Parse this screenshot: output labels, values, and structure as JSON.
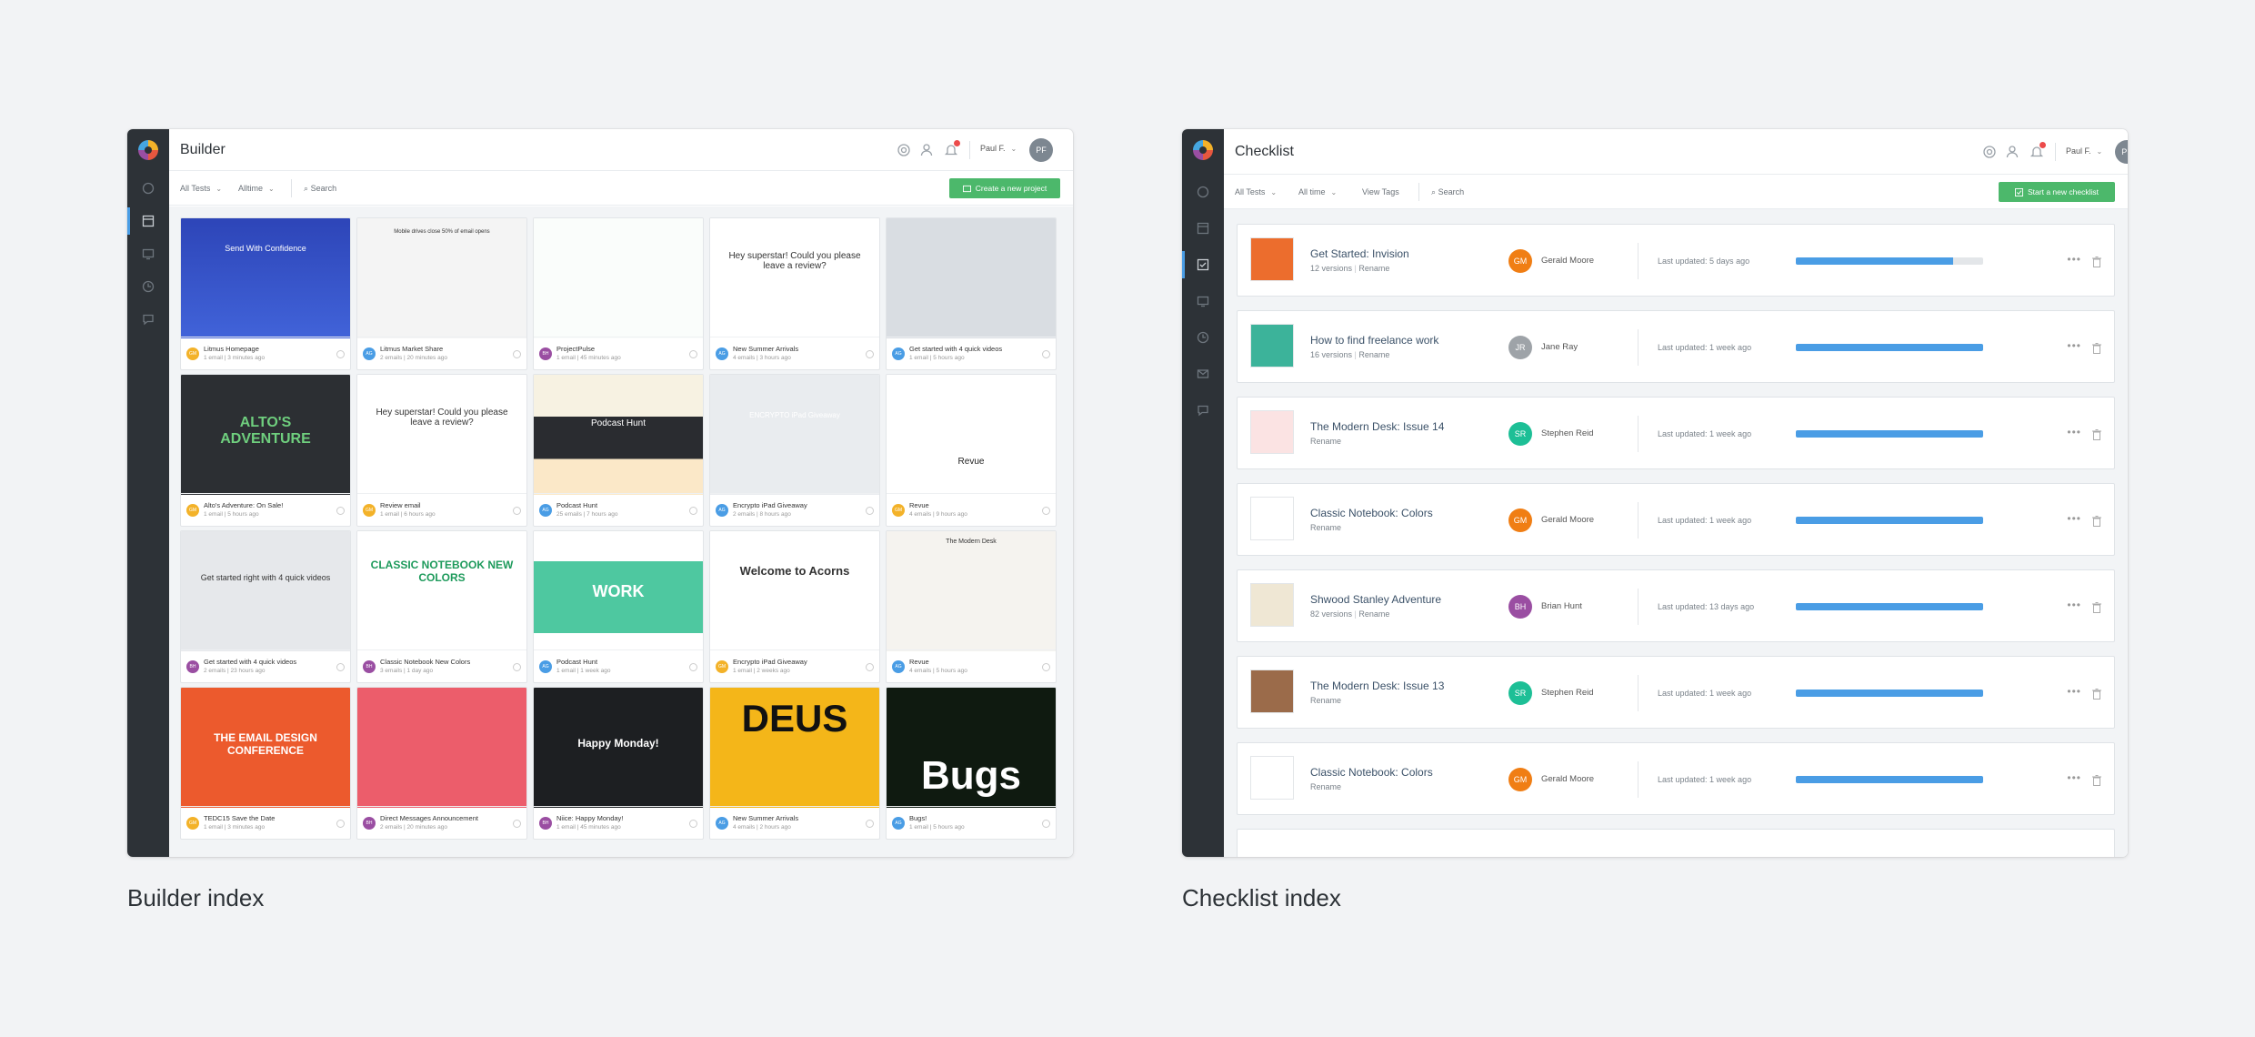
{
  "builder": {
    "title": "Builder",
    "user": "Paul F.",
    "avatar": "PF",
    "filters": {
      "tests": "All Tests",
      "time": "Alltime",
      "search": "Search"
    },
    "create_button": "Create a new project",
    "caption": "Builder index",
    "cards": [
      {
        "name": "Litmus Homepage",
        "meta": "1 email | 3 minutes ago",
        "avatar": "GM",
        "color": "#f3b229",
        "thumb_text": "Send With Confidence"
      },
      {
        "name": "Litmus Market Share",
        "meta": "2 emails | 20 minutes ago",
        "avatar": "AG",
        "color": "#4a9de5",
        "thumb_text": "Mobile drives close 50% of email opens"
      },
      {
        "name": "ProjectPulse",
        "meta": "1 email | 45 minutes ago",
        "avatar": "BH",
        "color": "#9a4ea2",
        "thumb_text": ""
      },
      {
        "name": "New Summer Arrivals",
        "meta": "4 emails | 3 hours ago",
        "avatar": "AG",
        "color": "#4a9de5",
        "thumb_text": "Hey superstar! Could you please leave a review?"
      },
      {
        "name": "Get started with 4 quick videos",
        "meta": "1 email | 5 hours ago",
        "avatar": "AG",
        "color": "#4a9de5",
        "thumb_text": ""
      },
      {
        "name": "Alto's Adventure: On Sale!",
        "meta": "1 email | 5 hours ago",
        "avatar": "GM",
        "color": "#f3b229",
        "thumb_text": "ALTO'S ADVENTURE"
      },
      {
        "name": "Review email",
        "meta": "1 email | 6 hours ago",
        "avatar": "GM",
        "color": "#f3b229",
        "thumb_text": "Hey superstar! Could you please leave a review?"
      },
      {
        "name": "Podcast Hunt",
        "meta": "25 emails | 7 hours ago",
        "avatar": "AG",
        "color": "#4a9de5",
        "thumb_text": "Podcast Hunt"
      },
      {
        "name": "Encrypto iPad Giveaway",
        "meta": "2 emails | 8 hours ago",
        "avatar": "AG",
        "color": "#4a9de5",
        "thumb_text": "ENCRYPTO iPad Giveaway"
      },
      {
        "name": "Revue",
        "meta": "4 emails | 9 hours ago",
        "avatar": "GM",
        "color": "#f3b229",
        "thumb_text": "Revue"
      },
      {
        "name": "Get started with 4 quick videos",
        "meta": "2 emails | 23 hours ago",
        "avatar": "BH",
        "color": "#9a4ea2",
        "thumb_text": "Get started right with 4 quick videos"
      },
      {
        "name": "Classic Notebook New Colors",
        "meta": "3 emails | 1 day ago",
        "avatar": "BH",
        "color": "#9a4ea2",
        "thumb_text": "CLASSIC NOTEBOOK NEW COLORS"
      },
      {
        "name": "Podcast Hunt",
        "meta": "1 email | 1 week ago",
        "avatar": "AG",
        "color": "#4a9de5",
        "thumb_text": "WORK"
      },
      {
        "name": "Encrypto iPad Giveaway",
        "meta": "1 email | 2 weeks ago",
        "avatar": "GM",
        "color": "#f3b229",
        "thumb_text": "Welcome to Acorns"
      },
      {
        "name": "Revue",
        "meta": "4 emails | 5 hours ago",
        "avatar": "AG",
        "color": "#4a9de5",
        "thumb_text": "The Modern Desk"
      },
      {
        "name": "TEDC15 Save the Date",
        "meta": "1 email | 3 minutes ago",
        "avatar": "GM",
        "color": "#f3b229",
        "thumb_text": "THE EMAIL DESIGN CONFERENCE"
      },
      {
        "name": "Direct Messages Announcement",
        "meta": "2 emails | 20 minutes ago",
        "avatar": "BH",
        "color": "#9a4ea2",
        "thumb_text": ""
      },
      {
        "name": "Niice: Happy Monday!",
        "meta": "1 email | 45 minutes ago",
        "avatar": "BH",
        "color": "#9a4ea2",
        "thumb_text": "Happy Monday!"
      },
      {
        "name": "New Summer Arrivals",
        "meta": "4 emails | 2 hours ago",
        "avatar": "AG",
        "color": "#4a9de5",
        "thumb_text": "DEUS"
      },
      {
        "name": "Bugs!",
        "meta": "1 email | 5 hours ago",
        "avatar": "AG",
        "color": "#4a9de5",
        "thumb_text": "Bugs"
      }
    ]
  },
  "checklist": {
    "title": "Checklist",
    "user": "Paul F.",
    "avatar": "PF",
    "filters": {
      "tests": "All Tests",
      "time": "All time",
      "tags": "View Tags",
      "search": "Search"
    },
    "create_button": "Start a new checklist",
    "caption": "Checklist index",
    "rows": [
      {
        "title": "Get Started: Invision",
        "versions": "12 versions",
        "rename": "Rename",
        "owner": "Gerald Moore",
        "initials": "GM",
        "color": "#f07e14",
        "updated": "Last updated: 5 days ago",
        "progress": 0.84
      },
      {
        "title": "How to find freelance work",
        "versions": "16 versions",
        "rename": "Rename",
        "owner": "Jane Ray",
        "initials": "JR",
        "color": "#9ea3a8",
        "updated": "Last updated: 1 week ago",
        "progress": 1.0
      },
      {
        "title": "The Modern Desk: Issue 14",
        "versions": "",
        "rename": "Rename",
        "owner": "Stephen Reid",
        "initials": "SR",
        "color": "#1dbf96",
        "updated": "Last updated: 1 week ago",
        "progress": 1.0
      },
      {
        "title": "Classic Notebook: Colors",
        "versions": "",
        "rename": "Rename",
        "owner": "Gerald Moore",
        "initials": "GM",
        "color": "#f07e14",
        "updated": "Last updated: 1 week ago",
        "progress": 1.0
      },
      {
        "title": "Shwood Stanley Adventure",
        "versions": "82 versions",
        "rename": "Rename",
        "owner": "Brian Hunt",
        "initials": "BH",
        "color": "#9a4ea2",
        "updated": "Last updated: 13 days ago",
        "progress": 1.0
      },
      {
        "title": "The Modern Desk: Issue 13",
        "versions": "",
        "rename": "Rename",
        "owner": "Stephen Reid",
        "initials": "SR",
        "color": "#1dbf96",
        "updated": "Last updated: 1 week ago",
        "progress": 1.0
      },
      {
        "title": "Classic Notebook: Colors",
        "versions": "",
        "rename": "Rename",
        "owner": "Gerald Moore",
        "initials": "GM",
        "color": "#f07e14",
        "updated": "Last updated: 1 week ago",
        "progress": 1.0
      }
    ]
  }
}
